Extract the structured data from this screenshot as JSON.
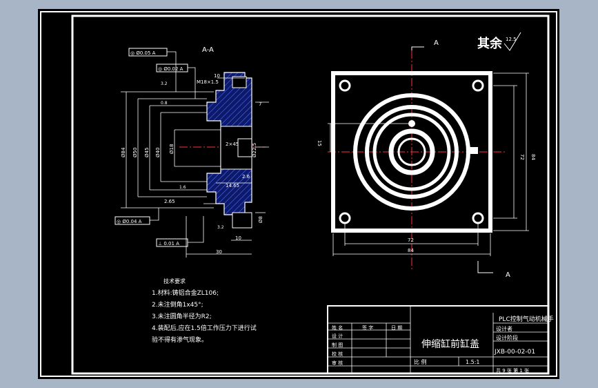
{
  "section_view": {
    "title": "A-A",
    "tol_frames": [
      "◎ Ø0.05 A",
      "◎ Ø0.02 A",
      "◎ Ø0.04 A",
      "⊥ 0.01 A"
    ],
    "dims": {
      "thread": "M18×1.5",
      "d1": "10",
      "d2": "Ø84",
      "d3": "Ø50",
      "d4": "Ø45",
      "d5": "Ø40",
      "d6": "Ø18",
      "d7": "2×45",
      "d8": "Ø22.5",
      "d9": "2.6",
      "d10": "14.65",
      "d11": "2.65",
      "d12": "Ø8",
      "d13": "30",
      "d14": "10",
      "d15": "7",
      "r1": "3.2",
      "r2": "0.8",
      "r3": "1.6",
      "r4": "3.2"
    }
  },
  "top_view": {
    "section_mark_top": "A",
    "section_mark_bottom": "A",
    "dims": {
      "w_inner": "72",
      "w_outer": "84",
      "h_inner": "72",
      "h_outer": "84",
      "offset": "15"
    }
  },
  "surface_note": {
    "text": "其余",
    "roughness": "12.5"
  },
  "tech_req": {
    "title": "技术要求",
    "items": [
      "1.材料:铸铝合金ZL106;",
      "2.未注倒角1x45°;",
      "3.未注圆角半径为R2;",
      "4.装配后,应在1.5倍工作压力下进行试",
      "验不得有渗气现象。"
    ]
  },
  "title_block": {
    "project": "PLC控制气动机械手",
    "part_name": "伸缩缸前缸盖",
    "drawing_no": "JXB-00-02-01",
    "scale_label": "比 例",
    "scale": "1.5:1",
    "sheet_info": "共 9 张 第 1 张",
    "rows": [
      "姓 名",
      "设 计",
      "制 图",
      "校 核",
      "审 核"
    ],
    "cols": [
      "签 字",
      "日 期"
    ],
    "fields": [
      "设计者",
      "设计阶段"
    ]
  }
}
